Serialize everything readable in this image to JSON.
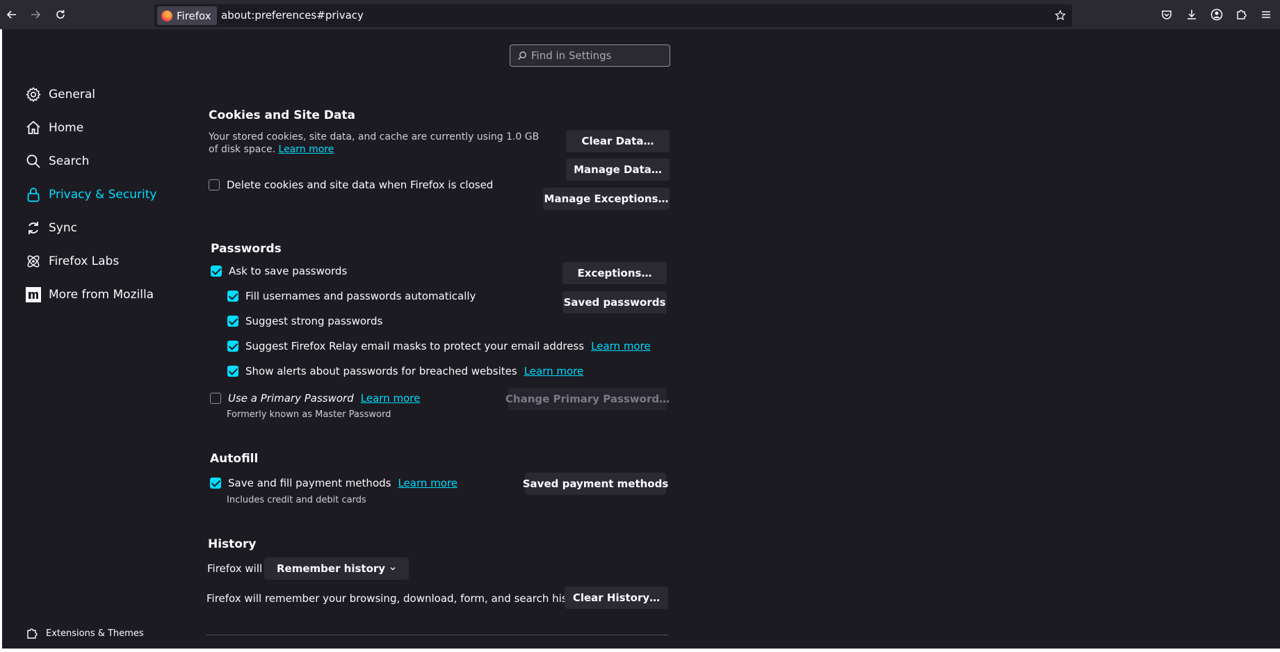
{
  "toolbar": {
    "identity_label": "Firefox",
    "url": "about:preferences#privacy"
  },
  "search": {
    "placeholder": "Find in Settings"
  },
  "sidebar": {
    "items": [
      {
        "label": "General"
      },
      {
        "label": "Home"
      },
      {
        "label": "Search"
      },
      {
        "label": "Privacy & Security",
        "selected": true
      },
      {
        "label": "Sync"
      },
      {
        "label": "Firefox Labs"
      },
      {
        "label": "More from Mozilla"
      }
    ],
    "footer": "Extensions & Themes"
  },
  "cookies": {
    "title": "Cookies and Site Data",
    "desc": "Your stored cookies, site data, and cache are currently using 1.0 GB of disk space.",
    "learn_more": "Learn more",
    "delete_label": "Delete cookies and site data when Firefox is closed",
    "clear_data": "Clear Data…",
    "manage_data": "Manage Data…",
    "manage_exceptions": "Manage Exceptions…"
  },
  "passwords": {
    "title": "Passwords",
    "ask_save": "Ask to save passwords",
    "fill_auto": "Fill usernames and passwords automatically",
    "suggest_strong": "Suggest strong passwords",
    "relay": "Suggest Firefox Relay email masks to protect your email address",
    "breach_alerts": "Show alerts about passwords for breached websites",
    "primary_pw": "Use a Primary Password",
    "primary_note": "Formerly known as Master Password",
    "learn_more": "Learn more",
    "exceptions": "Exceptions…",
    "saved_passwords": "Saved passwords",
    "change_primary": "Change Primary Password…"
  },
  "autofill": {
    "title": "Autofill",
    "save_payment": "Save and fill payment methods",
    "learn_more": "Learn more",
    "note": "Includes credit and debit cards",
    "saved_payment": "Saved payment methods"
  },
  "history": {
    "title": "History",
    "firefox_will": "Firefox will",
    "mode": "Remember history",
    "desc": "Firefox will remember your browsing, download, form, and search history.",
    "clear_history": "Clear History…"
  },
  "colors": {
    "accent": "#00ddff",
    "background": "#1c1b22",
    "toolbar": "#2b2a33"
  }
}
